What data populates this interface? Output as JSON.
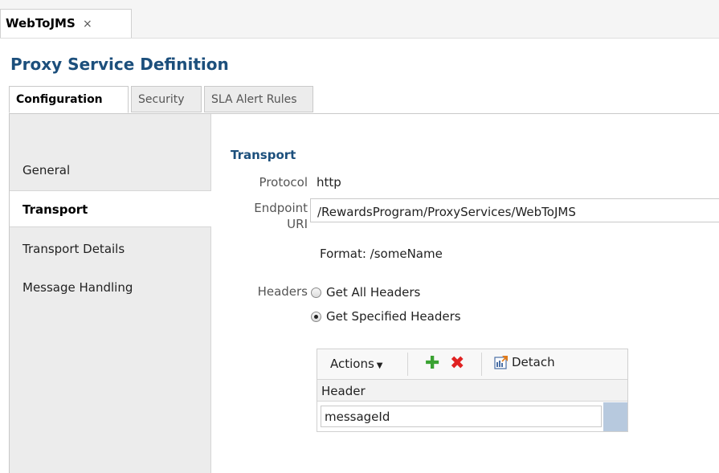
{
  "doc_tab": {
    "label": "WebToJMS",
    "close_glyph": "×"
  },
  "page_title": "Proxy Service Definition",
  "tabs": [
    {
      "label": "Configuration",
      "active": true
    },
    {
      "label": "Security",
      "active": false
    },
    {
      "label": "SLA Alert Rules",
      "active": false
    }
  ],
  "sidebar": {
    "items": [
      {
        "label": "General",
        "active": false
      },
      {
        "label": "Transport",
        "active": true
      },
      {
        "label": "Transport Details",
        "active": false
      },
      {
        "label": "Message Handling",
        "active": false
      }
    ]
  },
  "transport": {
    "section_title": "Transport",
    "protocol_label": "Protocol",
    "protocol_value": "http",
    "endpoint_label_line1": "Endpoint",
    "endpoint_label_line2": "URI",
    "endpoint_value": "/RewardsProgram/ProxyServices/WebToJMS",
    "format_hint": "Format: /someName",
    "headers_label": "Headers",
    "header_options": [
      {
        "label": "Get All Headers",
        "checked": false
      },
      {
        "label": "Get Specified Headers",
        "checked": true
      }
    ]
  },
  "headers_table": {
    "actions_label": "Actions",
    "detach_label": "Detach",
    "column_header": "Header",
    "rows": [
      {
        "value": "messageId"
      }
    ]
  },
  "colors": {
    "title": "#1c4f7c",
    "add": "#3aa232",
    "delete": "#e02222",
    "selection": "#b7c9de"
  }
}
